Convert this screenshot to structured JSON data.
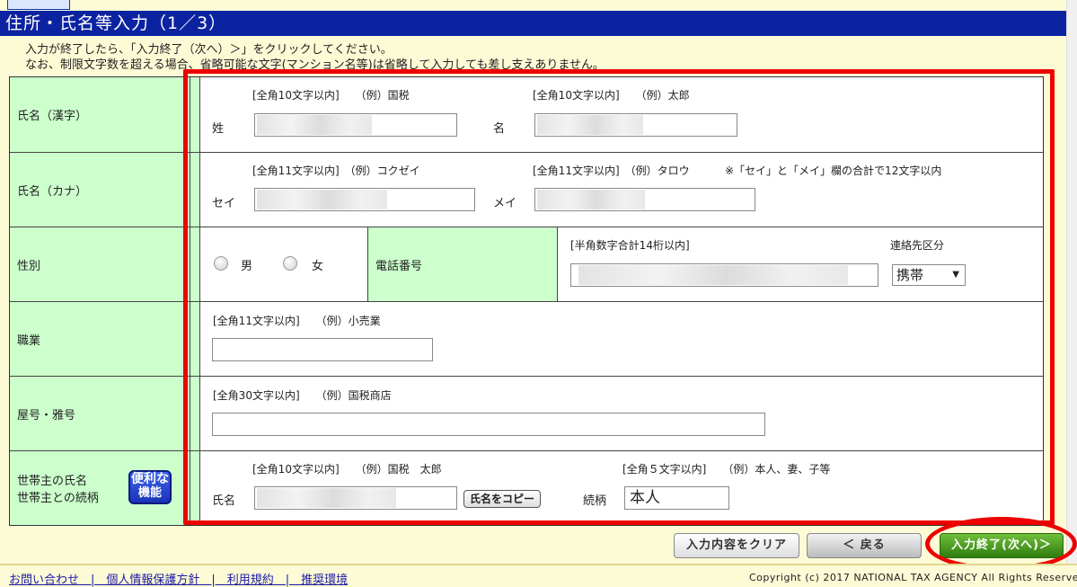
{
  "header": {
    "title": "住所・氏名等入力（1／3）"
  },
  "intro": {
    "line1": "入力が終了したら、「入力終了（次へ）＞」をクリックしてください。",
    "line2": "なお、制限文字数を超える場合、省略可能な文字(マンション名等)は省略して入力しても差し支えありません。"
  },
  "name_kanji": {
    "label": "氏名（漢字）",
    "sei_hint": "[全角10文字以内]　　（例）国税",
    "mei_hint": "[全角10文字以内]　　（例）太郎",
    "sei_label": "姓",
    "mei_label": "名"
  },
  "name_kana": {
    "label": "氏名（カナ）",
    "sei_hint": "[全角11文字以内]　（例）コクゼイ",
    "mei_hint": "[全角11文字以内]　（例）タロウ",
    "note": "※「セイ」と「メイ」欄の合計で12文字以内",
    "sei_label": "セイ",
    "mei_label": "メイ"
  },
  "gender": {
    "label": "性別",
    "male": "男",
    "female": "女"
  },
  "phone": {
    "label": "電話番号",
    "hint": "[半角数字合計14桁以内]",
    "contact_label": "連絡先区分",
    "contact_value": "携帯"
  },
  "occupation": {
    "label": "職業",
    "hint": "[全角11文字以内]　　（例）小売業"
  },
  "trade_name": {
    "label": "屋号・雅号",
    "hint": "[全角30文字以内]　　（例）国税商店"
  },
  "householder": {
    "label_line1": "世帯主の氏名",
    "label_line2": "世帯主との続柄",
    "benri_line1": "便利な",
    "benri_line2": "機能",
    "name_hint": "[全角10文字以内]　　（例）国税　太郎",
    "rel_hint": "[全角５文字以内]　　（例）本人、妻、子等",
    "name_label": "氏名",
    "copy_button": "氏名をコピー",
    "rel_label": "続柄",
    "rel_value": "本人"
  },
  "buttons": {
    "clear": "入力内容をクリア",
    "back": "＜ 戻る",
    "next": "入力終了(次へ)＞"
  },
  "footer": {
    "links": "お問い合わせ　|　個人情報保護方針　|　利用規約　|　推奨環境",
    "copyright": "Copyright (c) 2017 NATIONAL TAX AGENCY All Rights Reserved."
  }
}
